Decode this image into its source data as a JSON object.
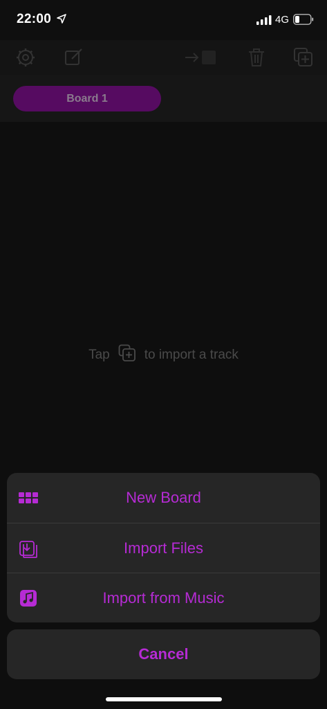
{
  "status_bar": {
    "time": "22:00",
    "network": "4G",
    "icons": [
      "location-arrow-icon",
      "cellular-signal-icon",
      "battery-icon"
    ]
  },
  "toolbar": {
    "icons": [
      "settings-gear-icon",
      "edit-icon",
      "move-to-board-icon",
      "trash-icon",
      "add-copy-icon"
    ]
  },
  "tabs": [
    {
      "label": "Board 1"
    }
  ],
  "empty_state": {
    "prefix": "Tap",
    "icon": "add-copy-icon",
    "suffix": "to import a track"
  },
  "action_sheet": {
    "items": [
      {
        "label": "New Board",
        "icon": "grid-icon"
      },
      {
        "label": "Import Files",
        "icon": "import-tray-icon"
      },
      {
        "label": "Import from Music",
        "icon": "music-note-icon"
      }
    ],
    "cancel_label": "Cancel"
  },
  "colors": {
    "accent": "#b62bd4",
    "tab_background": "#560b61",
    "sheet_background": "#262626"
  }
}
